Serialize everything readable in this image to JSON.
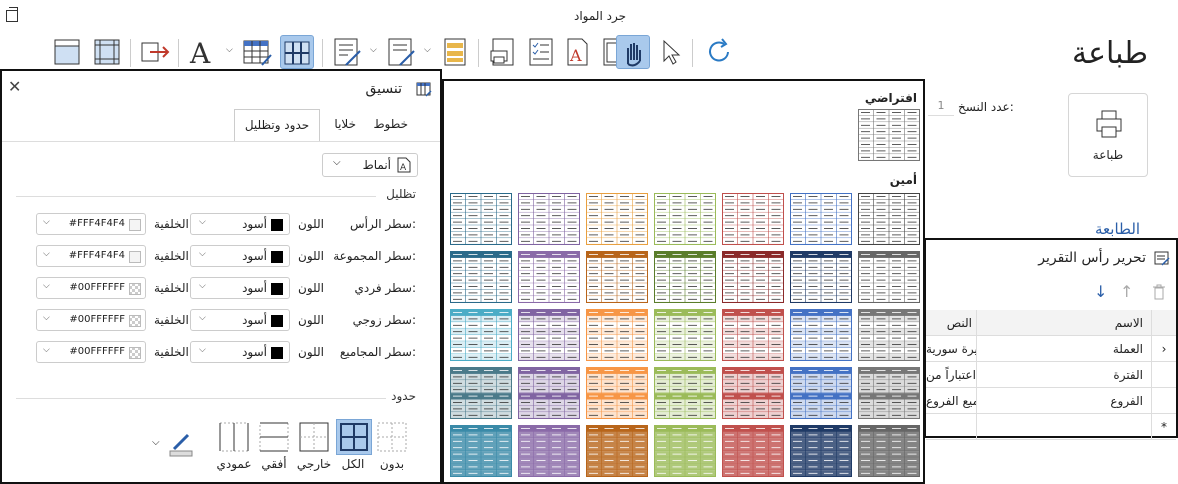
{
  "window": {
    "title": "جرد المواد"
  },
  "toolbar": {
    "items": [
      "page-layout-icon",
      "margins-icon",
      "export-icon",
      "font-icon",
      "table-format-icon",
      "grid-all-icon",
      "edit-form-icon",
      "edit-form-2-icon",
      "report-icon",
      "print-preview-icon",
      "checklist-icon",
      "pdf-icon",
      "page-icon",
      "hand-icon",
      "pointer-icon",
      "refresh-icon"
    ]
  },
  "print": {
    "title": "طباعة",
    "copies_label": "عدد النسخ:",
    "copies_value": "1",
    "button_label": "طباعة",
    "printer_heading": "الطابعة"
  },
  "format_pane": {
    "title": "تنسيق",
    "tabs": [
      "خطوط",
      "خلايا",
      "حدود وتظليل"
    ],
    "styles_label": "أنماط",
    "shading_heading": "تظليل",
    "color_label": "اللون",
    "back_label": "الخلفية",
    "rows": [
      {
        "label": "سطر الرأس:",
        "color": "أسود",
        "back": "#FFF4F4F4",
        "back_hex": "#f4f4f4"
      },
      {
        "label": "سطر المجموعة:",
        "color": "أسود",
        "back": "#FFF4F4F4",
        "back_hex": "#f4f4f4"
      },
      {
        "label": "سطر فردي:",
        "color": "أسود",
        "back": "#00FFFFFF",
        "back_hex": "transparent"
      },
      {
        "label": "سطر زوجي:",
        "color": "أسود",
        "back": "#00FFFFFF",
        "back_hex": "transparent"
      },
      {
        "label": "سطر المجاميع:",
        "color": "أسود",
        "back": "#00FFFFFF",
        "back_hex": "transparent"
      }
    ],
    "borders_heading": "حدود",
    "border_options": [
      "بدون",
      "الكل",
      "خارجي",
      "أفقي",
      "عمودي"
    ],
    "border_selected": "الكل"
  },
  "gallery": {
    "default_label": "افتراضي",
    "amin_label": "أمين",
    "rows": [
      [
        "#444444",
        "#1f3a66",
        "#8b2a2a",
        "#5a7d2a",
        "#8a5a9a",
        "#2a6a8a",
        "#d07a2a",
        "#a8a8c8"
      ],
      [
        "#777777",
        "#4472c4",
        "#c0504d",
        "#9bbb59",
        "#f79646",
        "#8064a2",
        "#4bacc6",
        "#c8c8c8"
      ],
      [
        "#888888",
        "#4472c4",
        "#c0504d",
        "#9bbb59",
        "#f79646",
        "#8064a2",
        "#4bacc6",
        "#4a7a8a"
      ],
      [
        "#777777",
        "#2a4a7a",
        "#d26a6a",
        "#7a9a3a",
        "#b8651a",
        "#8a6aa8",
        "#3a8aa8",
        "#888888"
      ]
    ],
    "top_row_colors": [
      "#444444",
      "#4472c4",
      "#c0504d",
      "#9bbb59",
      "#d4a030",
      "#8064a2",
      "#4bacc6",
      "#555555"
    ]
  },
  "header_pane": {
    "title": "تحرير رأس التقرير",
    "columns": {
      "name": "الاسم",
      "text": "النص"
    },
    "rows": [
      {
        "name": "العملة",
        "text": "ليرة سورية"
      },
      {
        "name": "الفترة",
        "text": "اعتباراً من"
      },
      {
        "name": "الفروع",
        "text": "جميع الفروع"
      }
    ],
    "new_row_marker": "*",
    "current_row_marker": "›"
  }
}
